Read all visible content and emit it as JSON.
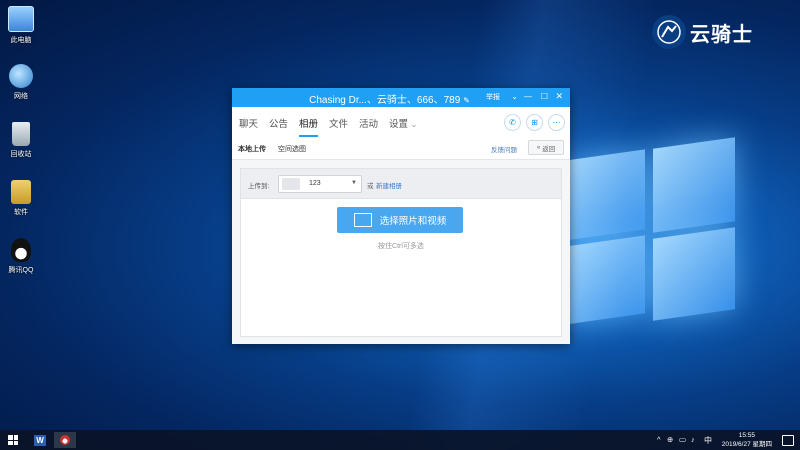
{
  "desktop": {
    "icons": [
      {
        "label": "此电脑",
        "icon": "computer-icon"
      },
      {
        "label": "网络",
        "icon": "network-icon"
      },
      {
        "label": "回收站",
        "icon": "recycle-bin-icon"
      },
      {
        "label": "软件",
        "icon": "folder-icon"
      },
      {
        "label": "腾讯QQ",
        "icon": "qq-penguin-icon"
      }
    ]
  },
  "brand": {
    "text": "云骑士",
    "icon": "knight-logo-icon"
  },
  "qq_window": {
    "title": "Chasing Dr...、云骑士、666、789",
    "title_edit_icon": "pencil-icon",
    "title_extra": "举报",
    "controls": [
      "chevron-down-icon",
      "minimize-icon",
      "maximize-icon",
      "close-icon"
    ],
    "tabs": [
      "聊天",
      "公告",
      "相册",
      "文件",
      "活动",
      "设置"
    ],
    "active_tab": "相册",
    "settings_caret": "⌄",
    "action_icons": [
      "phone-icon",
      "add-app-icon",
      "more-icon"
    ],
    "subtabs": [
      "本地上传",
      "空间选图"
    ],
    "feedback_link": "反馈问题",
    "back_button": "返回",
    "upload": {
      "label": "上传到:",
      "album_value": "123",
      "or_text": "或",
      "new_album": "新建相册",
      "select_button": "选择照片和视频",
      "hint": "按住Ctrl可多选"
    }
  },
  "taskbar": {
    "tray_icons": [
      "chevron-up-icon",
      "network-icon",
      "volume-icon",
      "speaker-icon"
    ],
    "ime": "中",
    "time": "15:55",
    "date": "2019/6/27 星期四"
  },
  "colors": {
    "accent": "#1fa0f5",
    "button": "#48a7ef",
    "desktop": "#0a4a9a"
  }
}
